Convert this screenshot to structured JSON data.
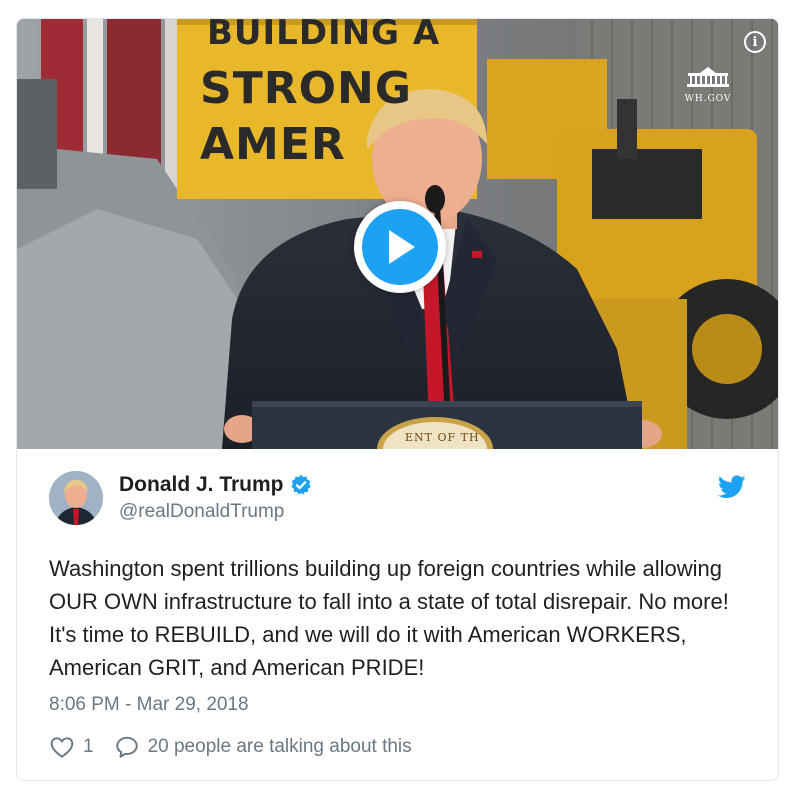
{
  "media": {
    "sign_lines": [
      "BUILDING A",
      "STRONG",
      "AMER"
    ],
    "seal_text": "ENT OF TH",
    "watermark_label": "WH.GOV",
    "info_glyph": "i",
    "play_icon": "play-icon"
  },
  "tweet": {
    "display_name": "Donald J. Trump",
    "handle": "@realDonaldTrump",
    "text": "Washington spent trillions building up foreign countries while allowing OUR OWN infrastructure to fall into a state of total disrepair. No more! It's time to REBUILD, and we will do it with American WORKERS, American GRIT, and American PRIDE!",
    "timestamp": "8:06 PM - Mar 29, 2018",
    "likes": "1",
    "conversation": "20 people are talking about this"
  },
  "colors": {
    "twitter_blue": "#1da1f2",
    "text_primary": "#1c2022",
    "text_secondary": "#697882",
    "border": "#e1e8ed"
  },
  "icons": [
    "info-icon",
    "white-house-icon",
    "play-icon",
    "verified-badge-icon",
    "twitter-bird-icon",
    "heart-icon",
    "reply-bubble-icon"
  ]
}
